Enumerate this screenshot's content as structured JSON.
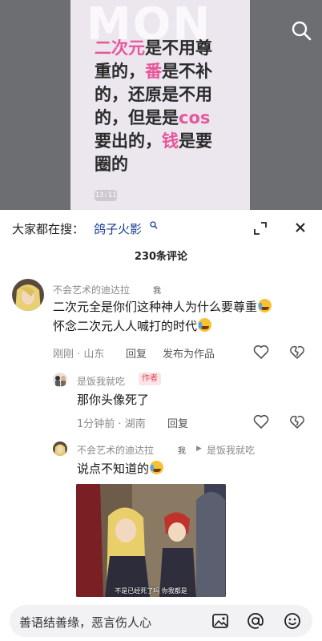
{
  "video": {
    "watermark": "MON",
    "quote_lines": [
      [
        {
          "t": "二次元",
          "pink": true
        },
        {
          "t": "是不用尊",
          "pink": false
        }
      ],
      [
        {
          "t": "重的，",
          "pink": false
        },
        {
          "t": "番",
          "pink": true
        },
        {
          "t": "是不补",
          "pink": false
        }
      ],
      [
        {
          "t": "的，还原是不用",
          "pink": false
        }
      ],
      [
        {
          "t": "的，但是是",
          "pink": false
        },
        {
          "t": "cos",
          "pink": true
        }
      ],
      [
        {
          "t": "要出的，",
          "pink": false
        },
        {
          "t": "钱",
          "pink": true
        },
        {
          "t": "是要",
          "pink": false
        }
      ],
      [
        {
          "t": "圈的",
          "pink": false
        }
      ]
    ],
    "timestamp": "13:11",
    "accent_pink": "#e6579a"
  },
  "sheet": {
    "suggest_label": "大家都在搜：",
    "suggest_term": "鸽子火影",
    "comment_count": "230条评论"
  },
  "comments": {
    "c1": {
      "username": "不会艺术的迪达拉",
      "me_tag": "我",
      "line1": "二次元全是你们这种神人为什么要尊重",
      "line2": "怀念二次元人人喊打的时代",
      "time": "刚刚",
      "location": "山东",
      "reply": "回复",
      "publish": "发布为作品"
    },
    "c2": {
      "username": "是饭我就吃",
      "author_tag": "作者",
      "text": "那你头像死了",
      "time": "1分钟前",
      "location": "湖南",
      "reply": "回复"
    },
    "c3": {
      "username": "不会艺术的迪达拉",
      "me_tag": "我",
      "reply_to": "是饭我就吃",
      "text": "说点不知道的",
      "image_caption": "不是已经死了吗 你我都是"
    }
  },
  "input": {
    "placeholder": "善语结善缘，恶言伤人心"
  },
  "icons": [
    "search-icon",
    "search-suggest-icon",
    "collapse-icon",
    "close-icon",
    "heart-icon",
    "broken-heart-icon",
    "image-icon",
    "at-icon",
    "emoji-icon"
  ]
}
